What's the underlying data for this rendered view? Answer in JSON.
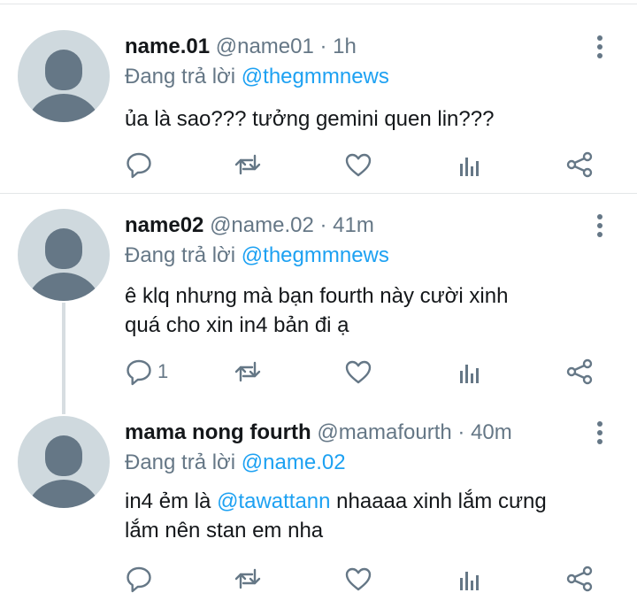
{
  "tweets": [
    {
      "display_name": "name.01",
      "handle": "@name01",
      "time": "· 1h",
      "reply_prefix": "Đang trả lời",
      "reply_to": "@thegmmnews",
      "text": "ủa là sao??? tưởng gemini quen lin???",
      "reply_count": ""
    },
    {
      "display_name": "name02",
      "handle": "@name.02",
      "time": "· 41m",
      "reply_prefix": "Đang trả lời",
      "reply_to": "@thegmmnews",
      "text_lines": [
        "ê klq nhưng mà bạn fourth này cười xinh",
        "quá cho xin in4 bản đi ạ"
      ],
      "reply_count": "1"
    },
    {
      "display_name": "mama nong fourth",
      "handle": "@mamafourth",
      "time": "· 40m",
      "reply_prefix": "Đang trả lời",
      "reply_to": "@name.02",
      "text_before": "in4 ẻm là ",
      "mention": "@tawattann",
      "text_after": " nhaaaa xinh lắm cưng",
      "text_line2": "lắm nên stan em nha",
      "reply_count": ""
    }
  ],
  "icons": [
    "reply-icon",
    "retweet-icon",
    "like-icon",
    "analytics-icon",
    "share-icon",
    "more-options-icon"
  ],
  "colors": {
    "link": "#1da1f2",
    "secondary_text": "#657786",
    "avatar_bg": "#cfd9de",
    "divider": "#e3e6e8"
  }
}
